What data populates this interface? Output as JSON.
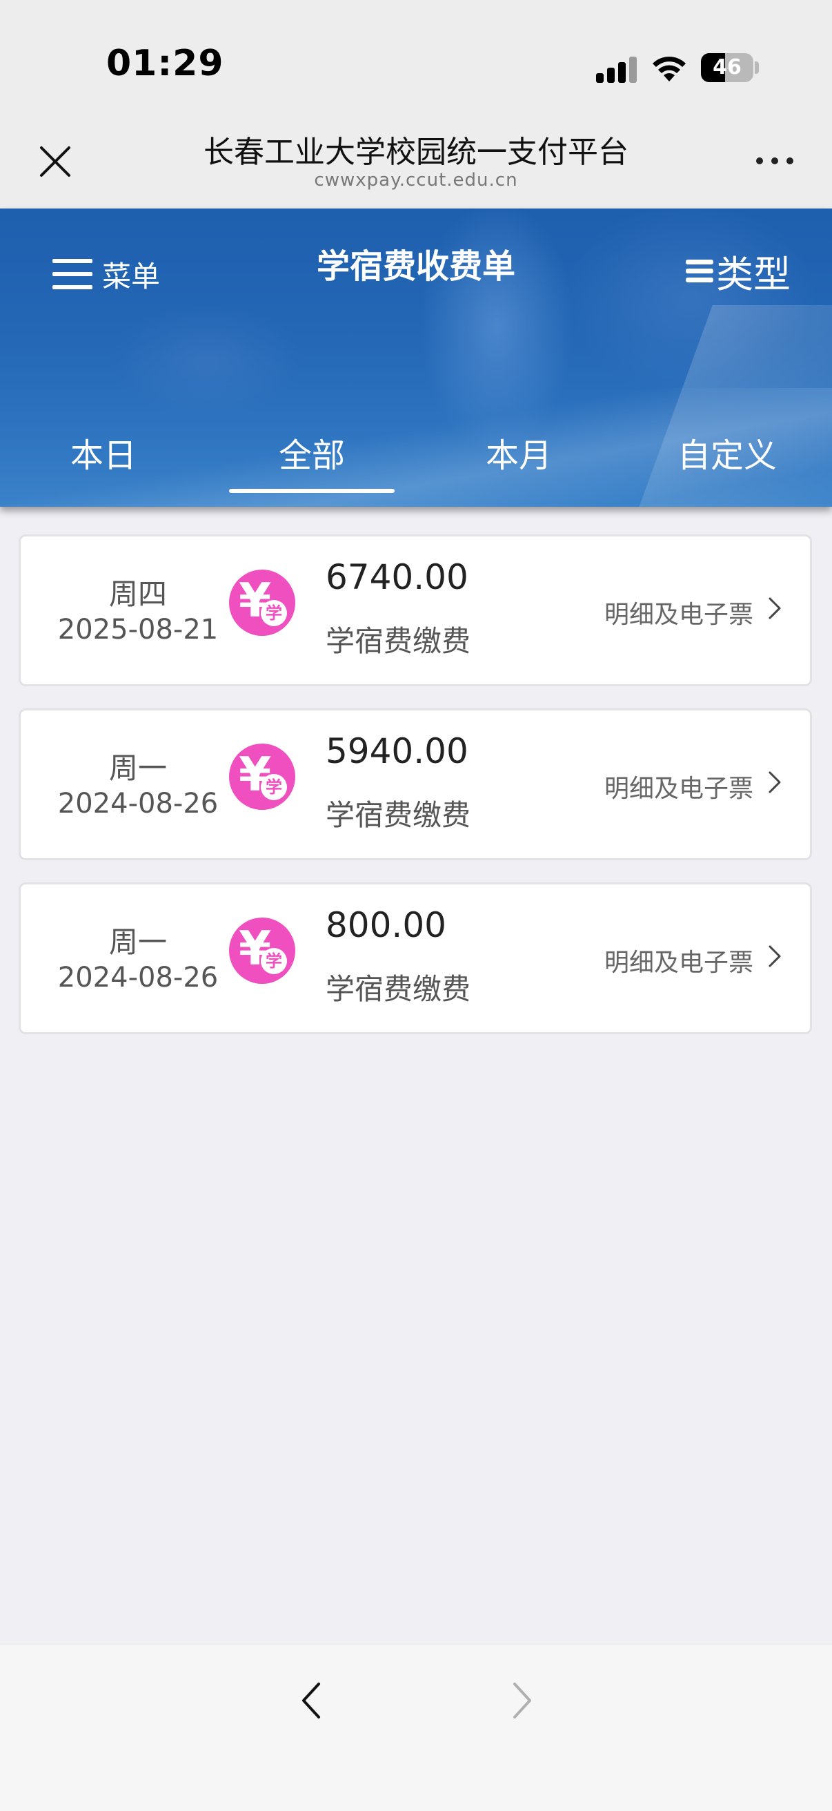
{
  "status_bar": {
    "time": "01:29",
    "battery": "46",
    "battery_level": 0.46
  },
  "browser": {
    "title": "长春工业大学校园统一支付平台",
    "url": "cwwxpay.ccut.edu.cn"
  },
  "header": {
    "menu_label": "菜单",
    "title": "学宿费收费单",
    "type_label": "类型"
  },
  "tabs": [
    {
      "label": "本日"
    },
    {
      "label": "全部"
    },
    {
      "label": "本月"
    },
    {
      "label": "自定义"
    }
  ],
  "active_tab": "全部",
  "records": [
    {
      "day": "周四",
      "date": "2025-08-21",
      "amount": "6740.00",
      "type": "学宿费缴费",
      "link": "明细及电子票"
    },
    {
      "day": "周一",
      "date": "2024-08-26",
      "amount": "5940.00",
      "type": "学宿费缴费",
      "link": "明细及电子票"
    },
    {
      "day": "周一",
      "date": "2024-08-26",
      "amount": "800.00",
      "type": "学宿费缴费",
      "link": "明细及电子票"
    }
  ],
  "icon": {
    "yen": "¥",
    "badge": "学",
    "color": "#ef4fbf"
  }
}
